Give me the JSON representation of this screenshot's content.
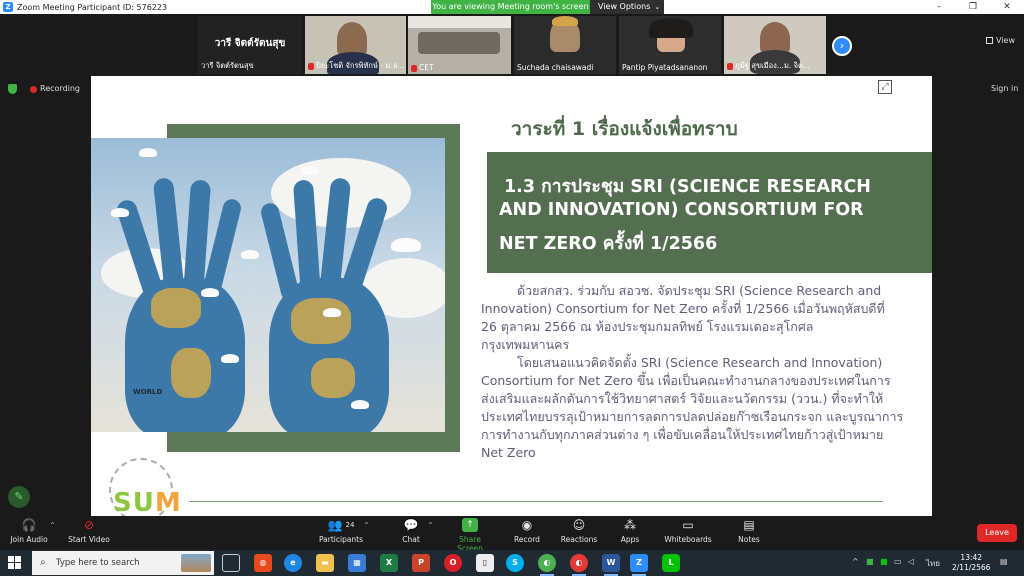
{
  "window": {
    "title": "Zoom Meeting Participant ID: 576223",
    "banner": "You are viewing Meeting room's screen",
    "view_options": "View Options"
  },
  "gallery": {
    "tiles": [
      {
        "name": "วารี จิตต์รัตนสุข",
        "big": "วารี จิตต์รัตนสุข"
      },
      {
        "name": "ปิยะโชติ จักรพิทักษ์ - ม.ล..."
      },
      {
        "name": "CET"
      },
      {
        "name": "Suchada chaisawadi"
      },
      {
        "name": "Pantip Piyatadsananon"
      },
      {
        "name": "ภูมิฐ สุขเมือง...ม. จิต..."
      }
    ],
    "view_label": "View"
  },
  "status": {
    "recording": "Recording",
    "sign_in": "Sign in"
  },
  "slide": {
    "agenda_title": "วาระที่ 1 เรื่องแจ้งเพื่อทราบ",
    "heading_lines": [
      "1.3 การประชุม SRI (SCIENCE RESEARCH",
      "AND INNOVATION) CONSORTIUM FOR",
      "NET ZERO ครั้งที่ 1/2566"
    ],
    "body_lines": [
      "ด้วยสกสว. ร่วมกับ สอวช. จัดประชุม SRI (Science Research and",
      "Innovation) Consortium for Net Zero ครั้งที่ 1/2566 เมื่อวันพฤหัสบดีที่",
      "26 ตุลาคม 2566 ณ ห้องประชุมกมลทิพย์ โรงแรมเดอะสุโกศล",
      "กรุงเทพมหานคร",
      "โดยเสนอแนวคิดจัดตั้ง SRI (Science Research and Innovation)",
      "Consortium for Net Zero ขึ้น เพื่อเป็นคณะทำงานกลางของประเทศในการ",
      "ส่งเสริมและผลักดันการใช้วิทยาศาสตร์ วิจัยและนวัตกรรม (ววน.) ที่จะทำให้",
      "ประเทศไทยบรรลุเป้าหมายการลดการปลดปล่อยก๊าซเรือนกระจก และบูรณาการ",
      "การทำงานกับทุกภาคส่วนต่าง ๆ เพื่อขับเคลื่อนให้ประเทศไทยก้าวสู่เป้าหมาย",
      "Net Zero"
    ],
    "image_text": "WORLD",
    "logo_text_a": "SU",
    "logo_text_b": "M"
  },
  "toolbar": {
    "join_audio": "Join Audio",
    "start_video": "Start Video",
    "participants": "Participants",
    "participants_count": "24",
    "chat": "Chat",
    "share_screen": "Share Screen",
    "record": "Record",
    "reactions": "Reactions",
    "apps": "Apps",
    "whiteboards": "Whiteboards",
    "notes": "Notes",
    "leave": "Leave"
  },
  "taskbar": {
    "search_placeholder": "Type here to search",
    "language": "ไทย",
    "time": "13:42",
    "date": "2/11/2566"
  },
  "colors": {
    "slide_green": "#546f50",
    "title_green": "#4d6a4a",
    "zoom_blue": "#2d8cff",
    "banner_green": "#3fb445",
    "leave_red": "#e02828"
  }
}
